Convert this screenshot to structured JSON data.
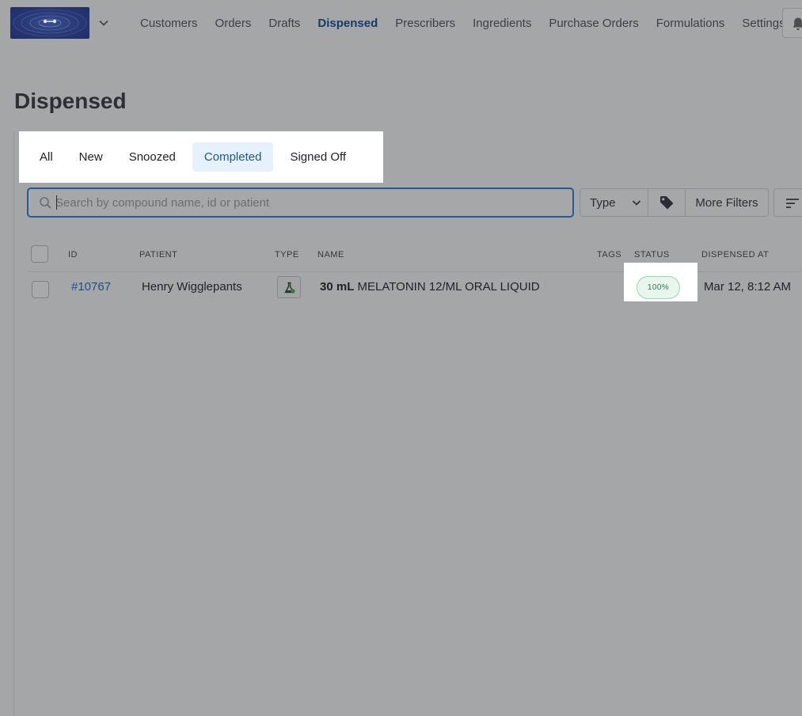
{
  "nav": {
    "items": [
      {
        "label": "Customers"
      },
      {
        "label": "Orders"
      },
      {
        "label": "Drafts"
      },
      {
        "label": "Dispensed",
        "active": true
      },
      {
        "label": "Prescribers"
      },
      {
        "label": "Ingredients"
      },
      {
        "label": "Purchase Orders"
      },
      {
        "label": "Formulations"
      },
      {
        "label": "Settings"
      }
    ],
    "icons": {
      "menu": "chevron-down-icon",
      "notifications": "bell-icon"
    }
  },
  "page": {
    "title": "Dispensed"
  },
  "tabs": [
    {
      "label": "All"
    },
    {
      "label": "New"
    },
    {
      "label": "Snoozed"
    },
    {
      "label": "Completed",
      "active": true
    },
    {
      "label": "Signed Off"
    }
  ],
  "search": {
    "placeholder": "Search by compound name, id or patient",
    "value": "",
    "icon": "search-icon"
  },
  "filters": {
    "type_label": "Type",
    "more_label": "More Filters",
    "tag_icon": "tag-icon",
    "sort_icon": "sort-icon"
  },
  "table": {
    "headers": {
      "id": "ID",
      "patient": "PATIENT",
      "type": "TYPE",
      "name": "NAME",
      "tags": "TAGS",
      "status": "STATUS",
      "dispensed_at": "DISPENSED AT"
    },
    "rows": [
      {
        "id": "#10767",
        "patient": "Henry Wigglepants",
        "type_icon": "compound-flask-icon",
        "quantity": "30 mL",
        "name": "MELATONIN 12/ML ORAL LIQUID",
        "tags": "",
        "status": "100%",
        "dispensed_at": "Mar 12, 8:12 AM"
      }
    ]
  },
  "colors": {
    "accent": "#163b6c",
    "link": "#1d4f86",
    "status_green": "#2c7d4f",
    "active_tab_bg": "#e6f1fb"
  }
}
